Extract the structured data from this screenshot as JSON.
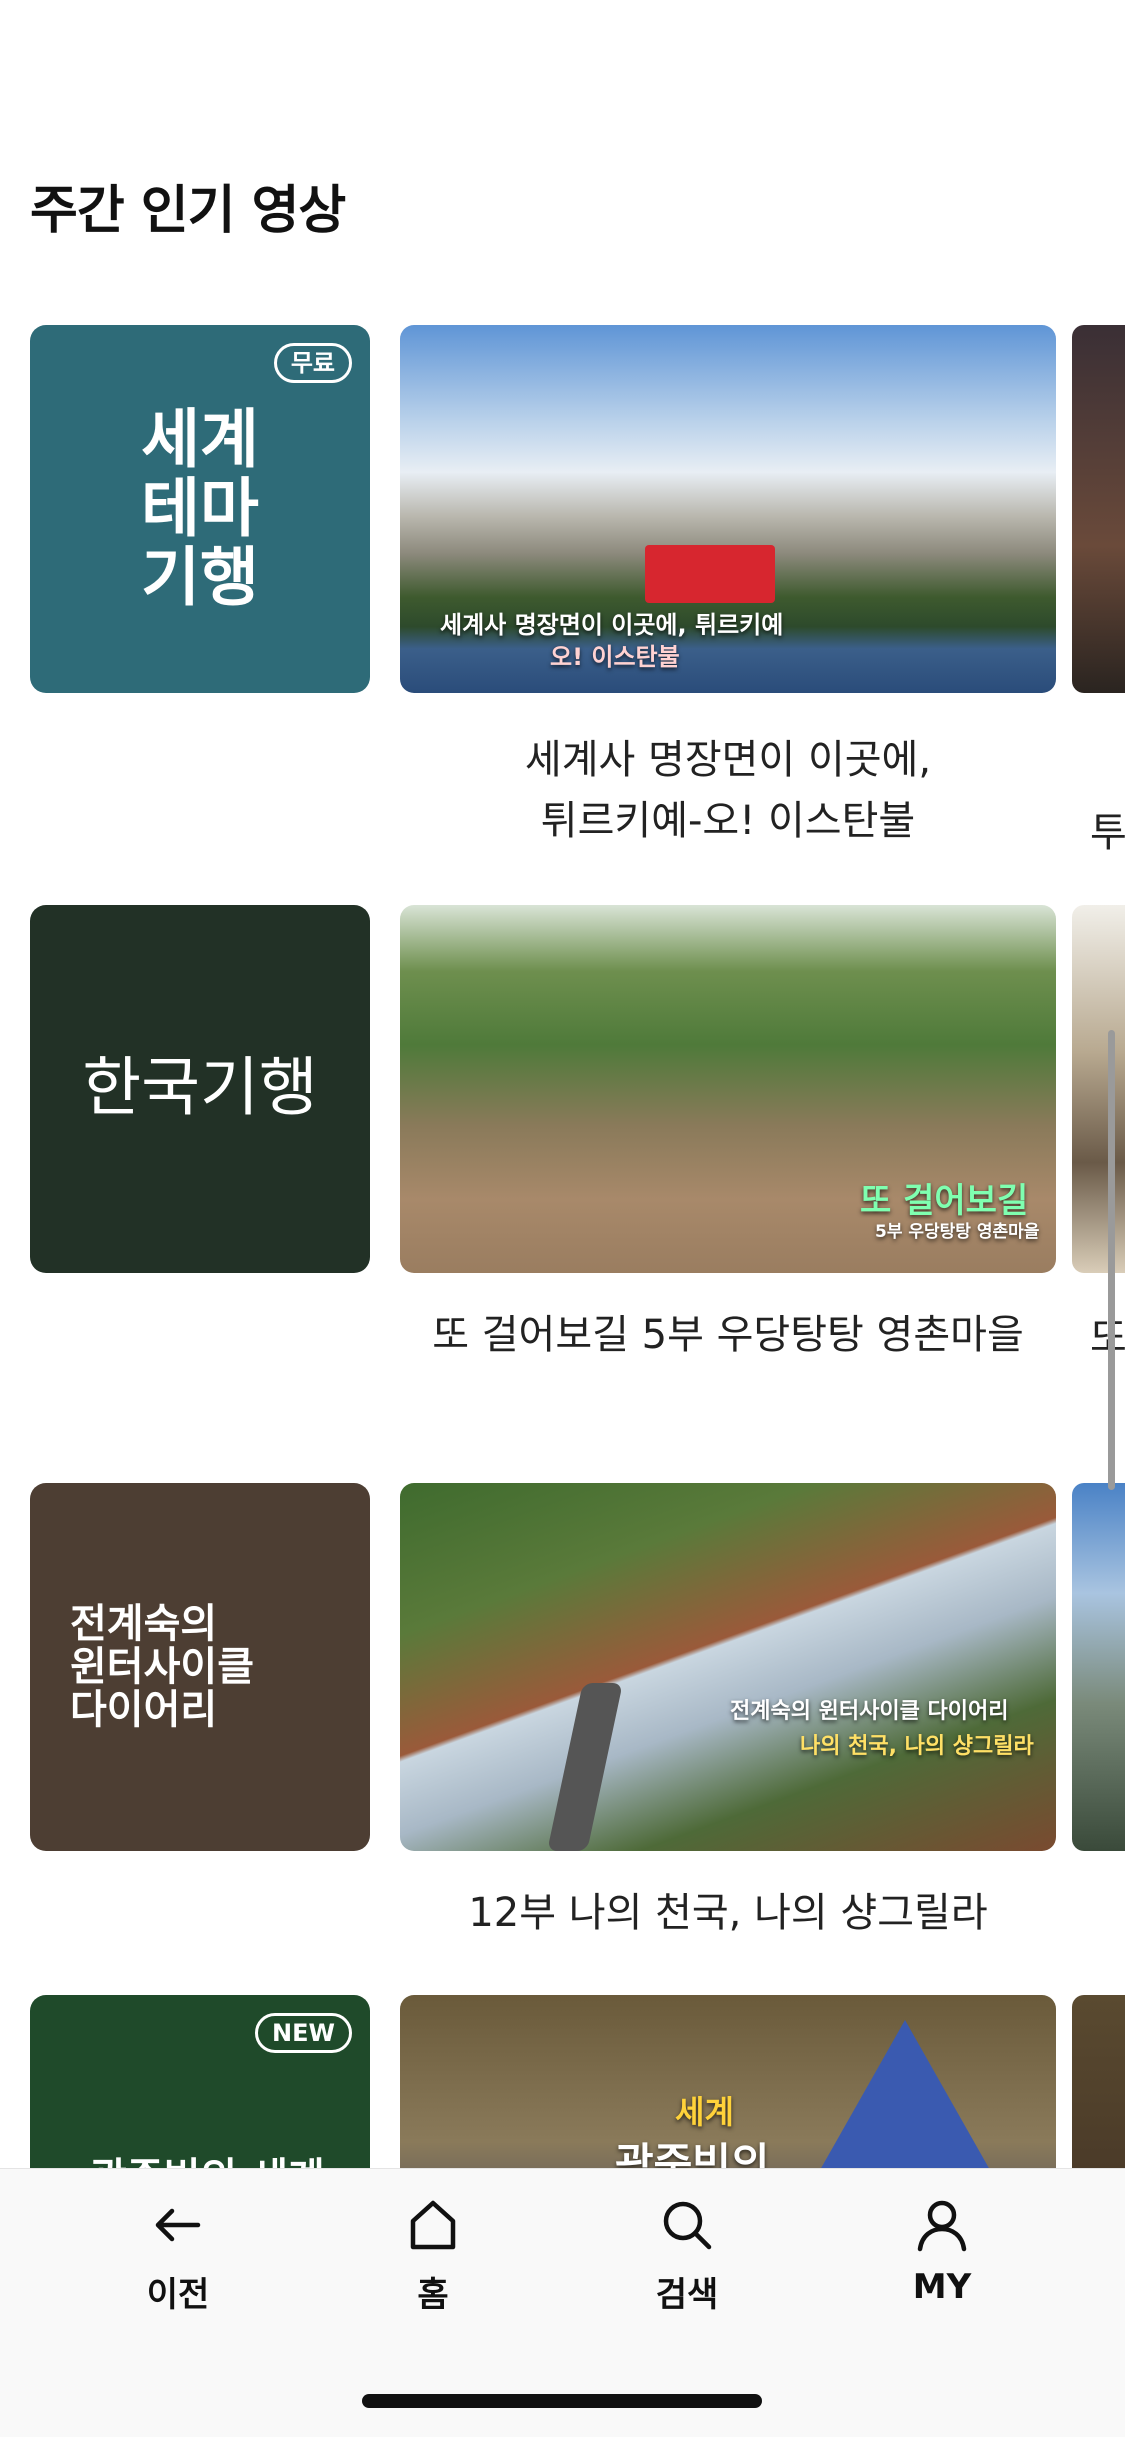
{
  "section": {
    "title": "주간 인기 영상"
  },
  "rows": [
    {
      "poster_title": "세계\n테마\n기행",
      "poster_badge": "무료",
      "thumb_overlay_line1": "세계사 명장면이 이곳에, 튀르키예",
      "thumb_overlay_line2": "오! 이스탄불",
      "caption": "세계사 명장면이 이곳에,\n튀르키예-오! 이스탄불",
      "peek_caption": "투"
    },
    {
      "poster_title": "한국기행",
      "thumb_overlay_line1": "또 걸어보길",
      "thumb_overlay_line2": "5부 우당탕탕 영촌마을",
      "caption": "또 걸어보길 5부 우당탕탕 영촌마을",
      "peek_caption": "또"
    },
    {
      "poster_title": "전계숙의\n윈터사이클\n다이어리",
      "thumb_overlay_line1": "전계숙의 윈터사이클 다이어리",
      "thumb_overlay_line2": "나의 천국, 나의 샹그릴라",
      "caption": "12부 나의 천국, 나의 샹그릴라"
    },
    {
      "poster_title": "곽준빈의 세계",
      "poster_badge": "NEW",
      "thumb_overlay_line1": "세계",
      "thumb_overlay_line2": "곽준빈의"
    }
  ],
  "nav": {
    "back": "이전",
    "home": "홈",
    "search": "검색",
    "my": "MY"
  },
  "colors": {
    "poster_blue": "#2e6b78",
    "poster_darkgreen": "#223126",
    "poster_brown": "#4d3e33",
    "poster_green": "#1f4a2a"
  }
}
